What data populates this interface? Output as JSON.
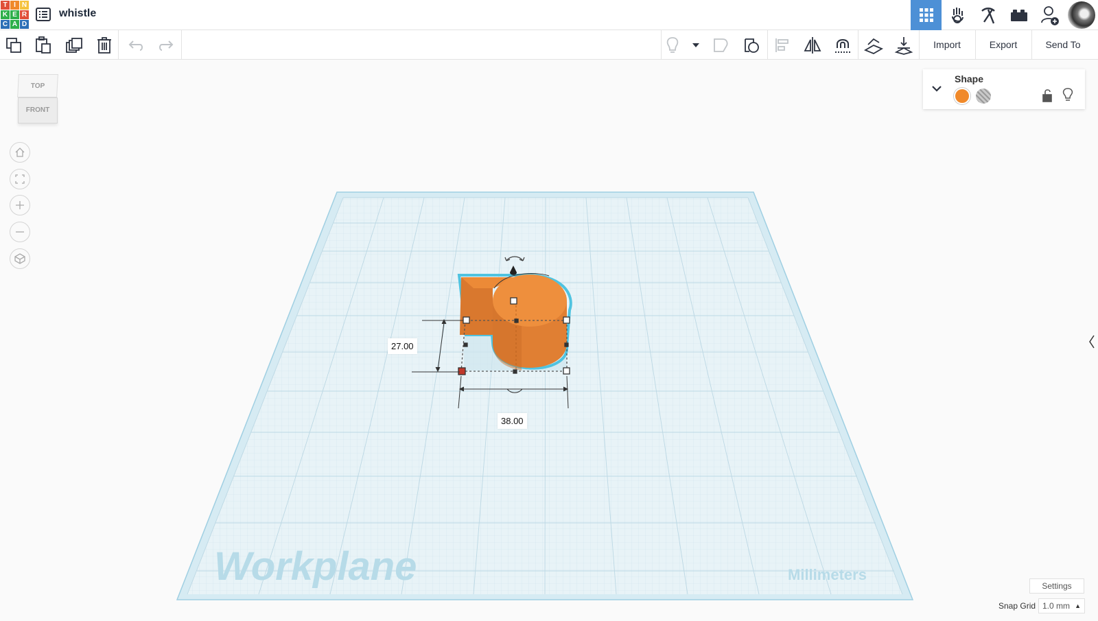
{
  "app": {
    "logo_letters": [
      "T",
      "I",
      "N",
      "K",
      "E",
      "R",
      "C",
      "A",
      "D"
    ],
    "logo_colors": [
      "#e04e39",
      "#f0892a",
      "#f5c23e",
      "#2eaf4a",
      "#2eaf4a",
      "#e04e39",
      "#2b6fb6",
      "#2eaf4a",
      "#2b6fb6"
    ],
    "doc_title": "whistle"
  },
  "toolbar": {
    "import_label": "Import",
    "export_label": "Export",
    "send_to_label": "Send To"
  },
  "viewcube": {
    "top_label": "TOP",
    "front_label": "FRONT"
  },
  "shape_panel": {
    "title": "Shape",
    "solid_color": "#f0892a"
  },
  "workplane": {
    "label": "Workplane",
    "units_label": "Millimeters"
  },
  "dimensions": {
    "height": "27.00",
    "width": "38.00"
  },
  "footer": {
    "settings_label": "Settings",
    "snap_grid_label": "Snap Grid",
    "snap_grid_value": "1.0 mm"
  },
  "colors": {
    "accent_blue": "#4d90d6",
    "shape_orange": "#ec8a37",
    "workplane_fill": "#e4f1f6",
    "selection_outline": "#4fc3e0"
  }
}
